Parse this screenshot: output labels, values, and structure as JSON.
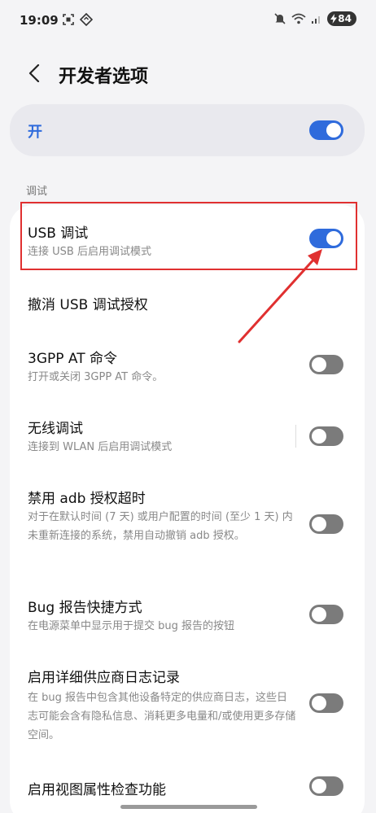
{
  "status_bar": {
    "time": "19:09",
    "battery_level": "84"
  },
  "header": {
    "title": "开发者选项"
  },
  "master_switch": {
    "label": "开",
    "enabled": true
  },
  "section": {
    "title": "调试"
  },
  "settings": [
    {
      "title": "USB 调试",
      "subtitle": "连接 USB 后启用调试模式",
      "toggle": "on"
    },
    {
      "title": "撤消 USB 调试授权",
      "subtitle": "",
      "toggle": "none"
    },
    {
      "title": "3GPP AT 命令",
      "subtitle": "打开或关闭 3GPP AT 命令。",
      "toggle": "off"
    },
    {
      "title": "无线调试",
      "subtitle": "连接到 WLAN 后启用调试模式",
      "toggle": "off"
    },
    {
      "title": "禁用 adb 授权超时",
      "subtitle": "对于在默认时间 (7 天) 或用户配置的时间 (至少 1 天) 内未重新连接的系统，禁用自动撤销 adb 授权。",
      "toggle": "off"
    },
    {
      "title": "Bug 报告快捷方式",
      "subtitle": "在电源菜单中显示用于提交 bug 报告的按钮",
      "toggle": "off"
    },
    {
      "title": "启用详细供应商日志记录",
      "subtitle": "在 bug 报告中包含其他设备特定的供应商日志，这些日志可能会含有隐私信息、消耗更多电量和/或使用更多存储空间。",
      "toggle": "off"
    },
    {
      "title": "启用视图属性检查功能",
      "subtitle": "",
      "toggle": "off"
    }
  ],
  "colors": {
    "accent": "#2f6bdc",
    "annotation": "#e03030",
    "toggle_off": "#7b7b7b"
  }
}
